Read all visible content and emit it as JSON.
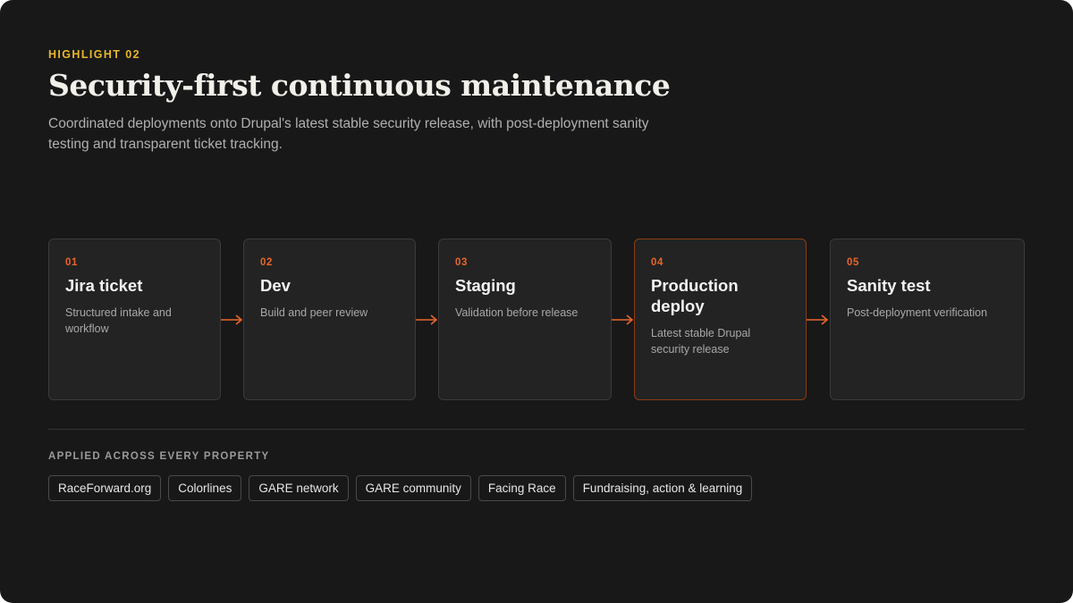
{
  "header": {
    "eyebrow": "HIGHLIGHT 02",
    "title": "Security-first continuous maintenance",
    "subtitle": "Coordinated deployments onto Drupal's latest stable security release, with post-deployment sanity testing and transparent ticket tracking."
  },
  "steps": [
    {
      "num": "01",
      "title": "Jira ticket",
      "desc": "Structured intake and workflow"
    },
    {
      "num": "02",
      "title": "Dev",
      "desc": "Build and peer review"
    },
    {
      "num": "03",
      "title": "Staging",
      "desc": "Validation before release"
    },
    {
      "num": "04",
      "title": "Production deploy",
      "desc": "Latest stable Drupal security release"
    },
    {
      "num": "05",
      "title": "Sanity test",
      "desc": "Post-deployment verification"
    }
  ],
  "applied": {
    "label": "APPLIED ACROSS EVERY PROPERTY",
    "tags": [
      "RaceForward.org",
      "Colorlines",
      "GARE network",
      "GARE community",
      "Facing Race",
      "Fundraising, action & learning"
    ]
  },
  "colors": {
    "accent": "#e8652a",
    "eyebrow": "#e8b72b",
    "background": "#181818",
    "card": "#232323",
    "highlight_border": "#8a3d12"
  },
  "icons": {
    "connector": "arrow-right-icon"
  }
}
